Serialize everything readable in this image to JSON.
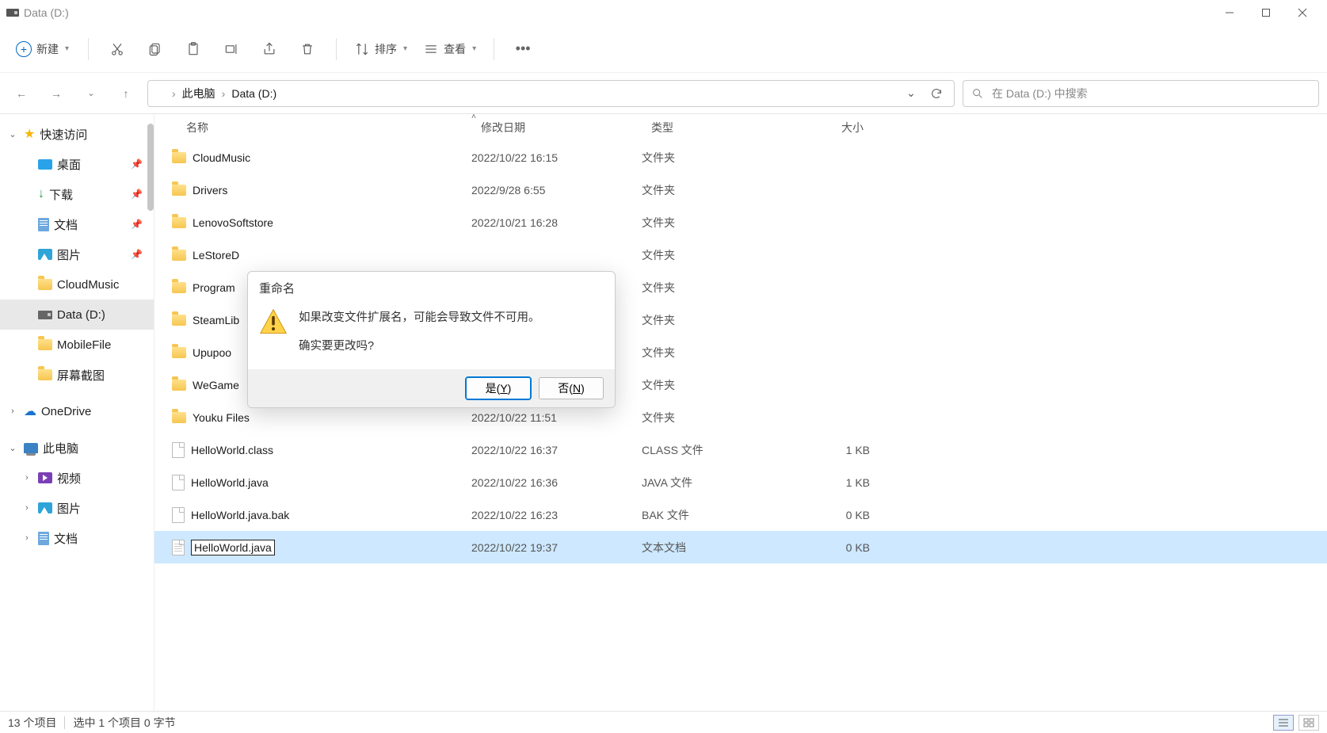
{
  "window": {
    "title": "Data (D:)"
  },
  "toolbar": {
    "new_label": "新建",
    "sort_label": "排序",
    "view_label": "查看"
  },
  "breadcrumb": {
    "pc": "此电脑",
    "drive": "Data (D:)"
  },
  "search": {
    "placeholder": "在 Data (D:) 中搜索"
  },
  "sidebar": {
    "quick": "快速访问",
    "desktop": "桌面",
    "downloads": "下载",
    "documents": "文档",
    "pictures": "图片",
    "cloudmusic": "CloudMusic",
    "data_d": "Data (D:)",
    "mobilefile": "MobileFile",
    "screenshots": "屏幕截图",
    "onedrive": "OneDrive",
    "this_pc": "此电脑",
    "videos": "视频",
    "pictures2": "图片",
    "documents2": "文档"
  },
  "columns": {
    "name": "名称",
    "date": "修改日期",
    "type": "类型",
    "size": "大小"
  },
  "type_labels": {
    "folder": "文件夹"
  },
  "files": [
    {
      "name": "CloudMusic",
      "date": "2022/10/22 16:15",
      "type": "文件夹",
      "size": "",
      "kind": "folder"
    },
    {
      "name": "Drivers",
      "date": "2022/9/28 6:55",
      "type": "文件夹",
      "size": "",
      "kind": "folder"
    },
    {
      "name": "LenovoSoftstore",
      "date": "2022/10/21 16:28",
      "type": "文件夹",
      "size": "",
      "kind": "folder"
    },
    {
      "name": "LeStoreD",
      "date": "",
      "type": "文件夹",
      "size": "",
      "kind": "folder"
    },
    {
      "name": "Program",
      "date": "",
      "type": "文件夹",
      "size": "",
      "kind": "folder"
    },
    {
      "name": "SteamLib",
      "date": "",
      "type": "文件夹",
      "size": "",
      "kind": "folder"
    },
    {
      "name": "Upupoo",
      "date": "",
      "type": "文件夹",
      "size": "",
      "kind": "folder"
    },
    {
      "name": "WeGame",
      "date": "",
      "type": "文件夹",
      "size": "",
      "kind": "folder"
    },
    {
      "name": "Youku Files",
      "date": "2022/10/22 11:51",
      "type": "文件夹",
      "size": "",
      "kind": "folder"
    },
    {
      "name": "HelloWorld.class",
      "date": "2022/10/22 16:37",
      "type": "CLASS 文件",
      "size": "1 KB",
      "kind": "file"
    },
    {
      "name": "HelloWorld.java",
      "date": "2022/10/22 16:36",
      "type": "JAVA 文件",
      "size": "1 KB",
      "kind": "file"
    },
    {
      "name": "HelloWorld.java.bak",
      "date": "2022/10/22 16:23",
      "type": "BAK 文件",
      "size": "0 KB",
      "kind": "file"
    },
    {
      "name": "HelloWorld.java",
      "date": "2022/10/22 19:37",
      "type": "文本文档",
      "size": "0 KB",
      "kind": "file",
      "selected": true,
      "renaming": true
    }
  ],
  "status": {
    "count": "13 个项目",
    "selection": "选中 1 个项目  0 字节"
  },
  "dialog": {
    "title": "重命名",
    "line1": "如果改变文件扩展名，可能会导致文件不可用。",
    "line2": "确实要更改吗?",
    "yes": "是(",
    "yes_key": "Y",
    "yes_end": ")",
    "no": "否(",
    "no_key": "N",
    "no_end": ")"
  }
}
